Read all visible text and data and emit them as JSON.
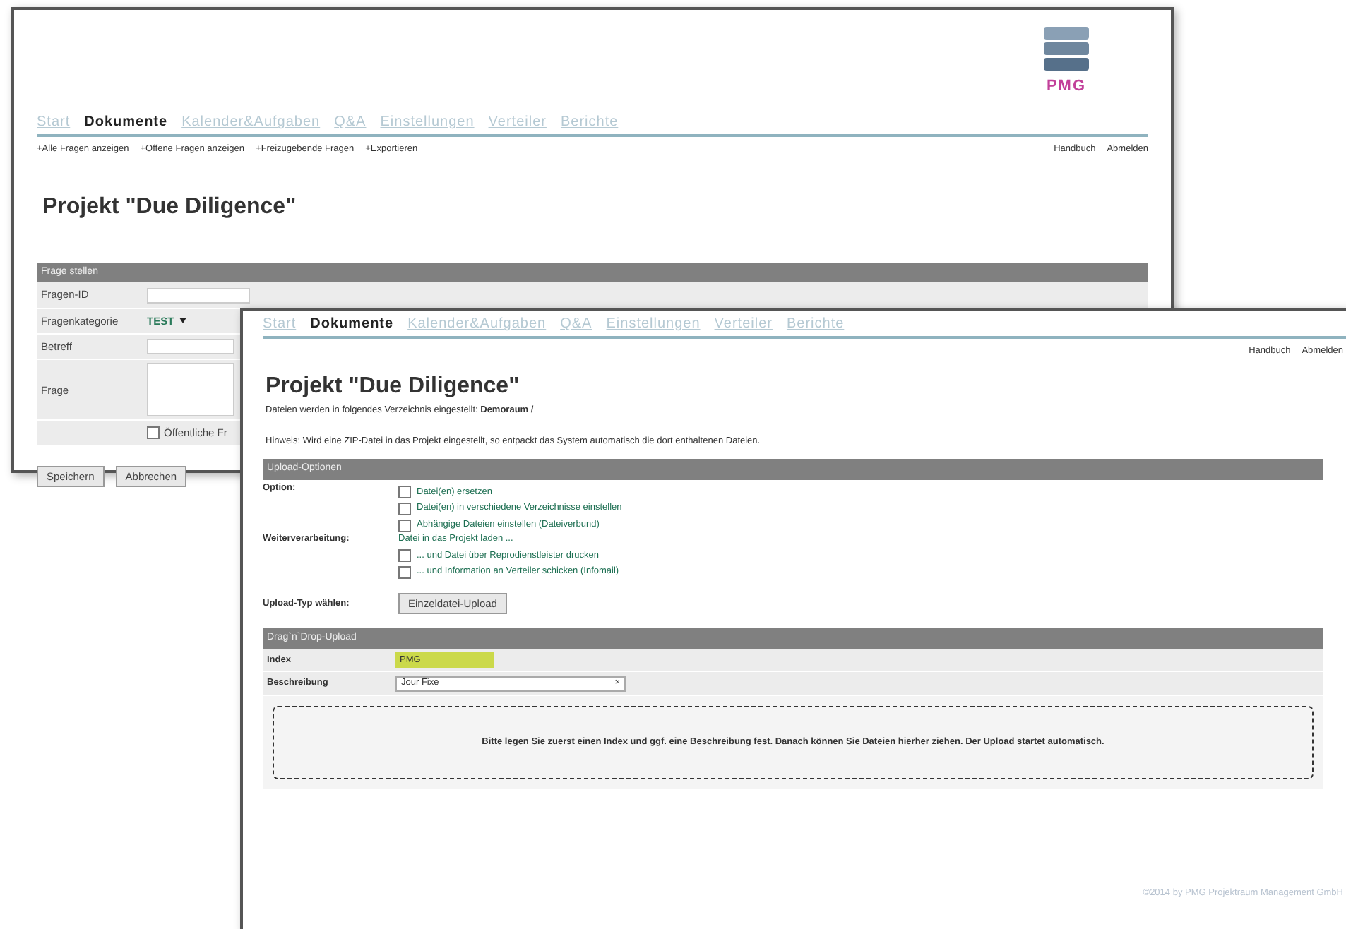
{
  "back_window": {
    "logo": {
      "text": "PMG"
    },
    "tabs": [
      {
        "label": "Start",
        "selected": false
      },
      {
        "label": "Dokumente",
        "selected": true
      },
      {
        "label": "Kalender&Aufgaben",
        "selected": false
      },
      {
        "label": "Q&A",
        "selected": false
      },
      {
        "label": "Einstellungen",
        "selected": false
      },
      {
        "label": "Verteiler",
        "selected": false
      },
      {
        "label": "Berichte",
        "selected": false
      }
    ],
    "sub_links": [
      "+Alle Fragen anzeigen",
      "+Offene Fragen anzeigen",
      "+Freizugebende Fragen",
      "+Exportieren"
    ],
    "top_links": [
      "Handbuch",
      "Abmelden"
    ],
    "title": "Projekt \"Due Diligence\"",
    "form": {
      "header": "Frage stellen",
      "fields": [
        {
          "label": "Fragen-ID",
          "kind": "input"
        },
        {
          "label": "Fragenkategorie",
          "kind": "select",
          "value": "TEST"
        },
        {
          "label": "Betreff",
          "kind": "input"
        },
        {
          "label": "Frage",
          "kind": "textarea"
        }
      ],
      "checkbox": {
        "label": "Öffentliche Fr",
        "checked": false
      }
    },
    "buttons": [
      "Speichern",
      "Abbrechen"
    ]
  },
  "front_window": {
    "tabs": [
      {
        "label": "Start",
        "selected": false
      },
      {
        "label": "Dokumente",
        "selected": true
      },
      {
        "label": "Kalender&Aufgaben",
        "selected": false
      },
      {
        "label": "Q&A",
        "selected": false
      },
      {
        "label": "Einstellungen",
        "selected": false
      },
      {
        "label": "Verteiler",
        "selected": false
      },
      {
        "label": "Berichte",
        "selected": false
      }
    ],
    "top_links": [
      "Handbuch",
      "Abmelden"
    ],
    "title": "Projekt \"Due Diligence\"",
    "directory_note": "Dateien werden in folgendes Verzeichnis eingestellt: **Demoraum /**",
    "hint": "Hinweis: Wird eine ZIP-Datei in das Projekt eingestellt, so entpackt das System automatisch die dort enthaltenen Dateien.",
    "upload_options": {
      "header": "Upload-Optionen",
      "option_label": "Option:",
      "options": [
        {
          "label": "Datei(en) ersetzen",
          "checked": false
        },
        {
          "label": "Datei(en) in verschiedene Verzeichnisse einstellen",
          "checked": false
        },
        {
          "label": "Abhängige Dateien einstellen (Dateiverbund)",
          "checked": false
        }
      ],
      "processing_label": "Weiterverarbeitung:",
      "processing_note": "Datei in das Projekt laden ...",
      "processing": [
        {
          "label": "... und Datei über Reprodienstleister drucken",
          "checked": false
        },
        {
          "label": "... und Information an Verteiler schicken (Infomail)",
          "checked": false
        }
      ],
      "upload_type_label": "Upload-Typ wählen:",
      "upload_type_button": "Einzeldatei-Upload"
    },
    "drag_drop": {
      "header": "Drag`n`Drop-Upload",
      "index": {
        "label": "Index",
        "value": "PMG"
      },
      "description": {
        "label": "Beschreibung",
        "value": "Jour Fixe",
        "clear": "×"
      },
      "dropzone": "Bitte legen Sie zuerst einen Index und ggf. eine Beschreibung fest. Danach können Sie Dateien hierher ziehen. Der Upload startet automatisch."
    },
    "footer": "©2014 by PMG Projektraum Management GmbH"
  }
}
